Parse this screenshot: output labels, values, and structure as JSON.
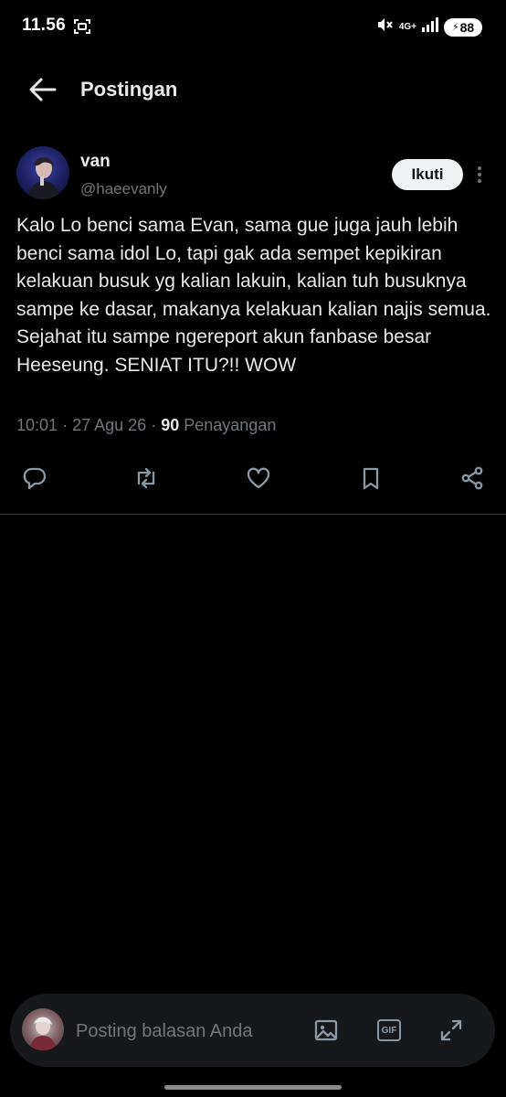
{
  "status_bar": {
    "time": "11.56",
    "network": "4G+",
    "battery": "88"
  },
  "header": {
    "title": "Postingan"
  },
  "post": {
    "author_name": "van",
    "author_handle": "@haeevanly",
    "follow_label": "Ikuti",
    "text": "Kalo Lo benci sama Evan, sama gue juga jauh lebih benci sama idol Lo, tapi gak ada sempet kepikiran kelakuan busuk yg kalian lakuin, kalian tuh busuknya sampe ke dasar, makanya kelakuan kalian najis semua. Sejahat itu sampe ngereport akun fanbase besar Heeseung. SENIAT ITU?!! WOW",
    "time": "10:01",
    "separator": "·",
    "date": "27 Agu 26",
    "views_count": "90",
    "views_label": "Penayangan"
  },
  "actions": [
    "reply-icon",
    "repost-icon",
    "like-icon",
    "bookmark-icon",
    "share-icon"
  ],
  "reply": {
    "placeholder": "Posting balasan Anda",
    "gif_label": "GIF"
  },
  "colors": {
    "background": "#000000",
    "text": "#e7e9ea",
    "secondary": "#71767b",
    "follow_bg": "#eff3f4",
    "reply_bar": "#16181c"
  }
}
